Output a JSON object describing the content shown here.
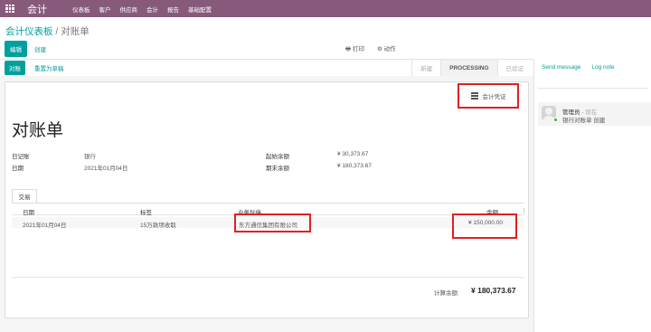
{
  "topbar": {
    "app_name": "会计",
    "menu": [
      "仪表板",
      "客户",
      "供应商",
      "会计",
      "报告",
      "基础配置"
    ]
  },
  "breadcrumb": {
    "parent": "会计仪表板",
    "separator": " / ",
    "current": "对账单"
  },
  "control_panel": {
    "edit": "编辑",
    "create": "创建",
    "print": "打印",
    "action": "动作"
  },
  "statusbar": {
    "reconcile": "对账",
    "reset": "重置为草稿",
    "stages": [
      "新建",
      "PROCESSING",
      "已验证"
    ],
    "current_stage": "PROCESSING"
  },
  "form": {
    "smart_button": "会计凭证",
    "title": "对账单",
    "journal_label": "日记账",
    "journal_value": "银行",
    "date_label": "日期",
    "date_value": "2021年01月04日",
    "start_label": "起始余额",
    "start_value": "¥ 30,373.67",
    "end_label": "期末余额",
    "end_value": "¥ 180,373.67"
  },
  "tab": {
    "label": "交易"
  },
  "table": {
    "columns": [
      "日期",
      "标签",
      "业务伙伴",
      "金额"
    ],
    "rows": [
      {
        "date": "2021年01月04日",
        "label": "15万款项收取",
        "partner": "东方通信集团有限公司",
        "amount": "¥ 150,000.00"
      }
    ]
  },
  "footer": {
    "balance_label": "计算余额:",
    "balance_value": "¥ 180,373.67"
  },
  "chatter": {
    "send_message": "Send message",
    "log_note": "Log note",
    "message": {
      "author": "管理员",
      "time": "现在",
      "body": "银行对账单 创建"
    }
  },
  "colors": {
    "brand": "#875a7b",
    "accent": "#00a09d",
    "highlight": "#e02020"
  }
}
